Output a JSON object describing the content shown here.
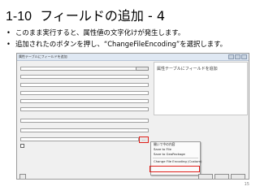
{
  "slide": {
    "title_num": "1-10",
    "title_text": "フィールドの追加 - 4",
    "bullets": [
      "このまま実行すると、属性値の文字化けが発生します。",
      "追加されたのボタンを押し、“ChangeFileEncoding”を選択します。"
    ],
    "page_number": "15"
  },
  "dialog": {
    "title": "属性テーブルにフィールドを追加",
    "right_title": "属性テーブルにフィールドを追加"
  },
  "menu": {
    "items": [
      "開いて中の内容",
      "Save to File",
      "Save to GeoPackage",
      "Change File Encoding (Custom)"
    ]
  }
}
